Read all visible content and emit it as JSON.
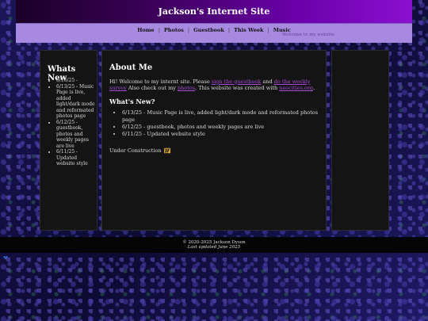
{
  "site": {
    "title": "Jackson's Internet Site"
  },
  "nav": {
    "items": [
      {
        "label": "Home"
      },
      {
        "label": "Photos"
      },
      {
        "label": "Guestbook"
      },
      {
        "label": "This Week"
      },
      {
        "label": "Music"
      }
    ],
    "separator": "|",
    "music_subtitle": "Welcome to my website"
  },
  "sidebar": {
    "title": "Whats New",
    "items": [
      {
        "text": "6/16/25 -"
      },
      {
        "text": "6/13/25 - Music Page is live, added light/dark mode and reformated photos page"
      },
      {
        "text": "6/12/25 - guestbook, photos and weekly pages are live"
      },
      {
        "text": "6/11/25 - Updated website style"
      }
    ]
  },
  "main": {
    "about_title": "About Me",
    "intro": {
      "t1": "Hi! Welcome to my internt site. Please ",
      "link1": "sign the guestbook",
      "t2": " and ",
      "link2": "do the weekly survey",
      "t3": " Also check out my ",
      "link3": "photos",
      "t4": ". This website was created with ",
      "link4": "neocities.org",
      "t5": "."
    },
    "whats_new_title": "What's New?",
    "updates": [
      {
        "text": "6/13/25 - Music Page is live, added light/dark mode and reformated photos page"
      },
      {
        "text": "6/12/25 - guestbook, photos and weekly pages are live"
      },
      {
        "text": "6/11/25 - Updated website style"
      }
    ],
    "construction": "Under Construction"
  },
  "footer": {
    "copyright": "© 2020-2025 Jackson Dyson",
    "updated": "Last updated June 2025"
  },
  "colors": {
    "header_gradient_end": "#8a10d0",
    "nav_bg": "#a889e0",
    "panel_bg": "#141414",
    "link": "#a64ad9"
  },
  "icons": {
    "construction": "construction-cone-icon",
    "corner": "bluesky-butterfly-icon"
  }
}
